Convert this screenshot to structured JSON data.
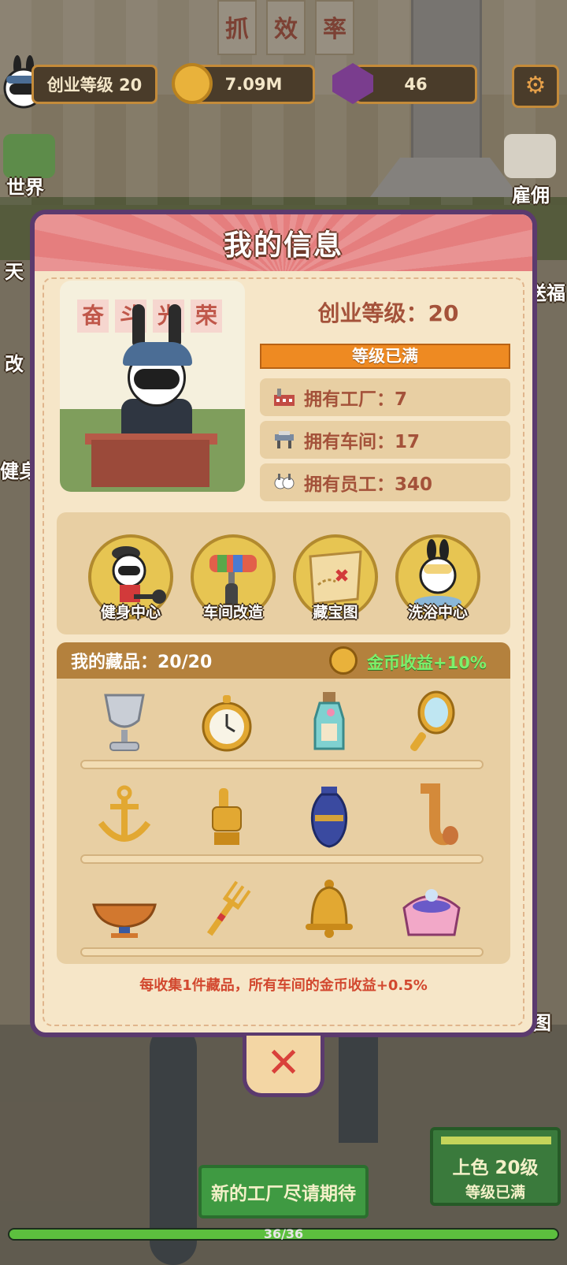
{
  "hud": {
    "level_label": "创业等级 20",
    "coins": "7.09M",
    "gems": "46"
  },
  "side_buttons": {
    "world": "世界",
    "hire": "雇佣",
    "tian_partial": "天",
    "gai_partial": "改",
    "jianshen_partial": "健身",
    "songli_partial": "送福",
    "map_partial": "图"
  },
  "scene": {
    "banners": [
      "抓",
      "效",
      "率"
    ]
  },
  "modal": {
    "title": "我的信息",
    "portrait_slogan": [
      "奋",
      "斗",
      "光",
      "荣"
    ],
    "level_text": "创业等级：20",
    "level_status": "等级已满",
    "stats": [
      {
        "icon": "factory-icon",
        "label": "拥有工厂：7"
      },
      {
        "icon": "workshop-icon",
        "label": "拥有车间：17"
      },
      {
        "icon": "staff-icon",
        "label": "拥有员工：340"
      }
    ],
    "shortcuts": [
      {
        "icon": "gym-icon",
        "label": "健身中心"
      },
      {
        "icon": "paint-roller-icon",
        "label": "车间改造"
      },
      {
        "icon": "treasure-map-icon",
        "label": "藏宝图"
      },
      {
        "icon": "bath-icon",
        "label": "洗浴中心"
      }
    ],
    "collection": {
      "title": "我的藏品：20/20",
      "bonus": "金币收益+10%",
      "items": [
        "silver-trophy-icon",
        "pocket-watch-icon",
        "message-bottle-icon",
        "hand-mirror-icon",
        "anchor-icon",
        "golden-hand-icon",
        "vase-icon",
        "saxophone-icon",
        "bowl-icon",
        "fork-icon",
        "bell-icon",
        "jewelry-box-icon"
      ]
    },
    "footer_note": "每收集1件藏品，所有车间的金币收益+0.5%"
  },
  "close_label": "✕",
  "bottom": {
    "new_factory_button": "新的工厂尽请期待",
    "panel_line1": "上色   20级",
    "panel_line2": "等级已满",
    "progress_text": "36/36",
    "progress_value": 1.0
  }
}
